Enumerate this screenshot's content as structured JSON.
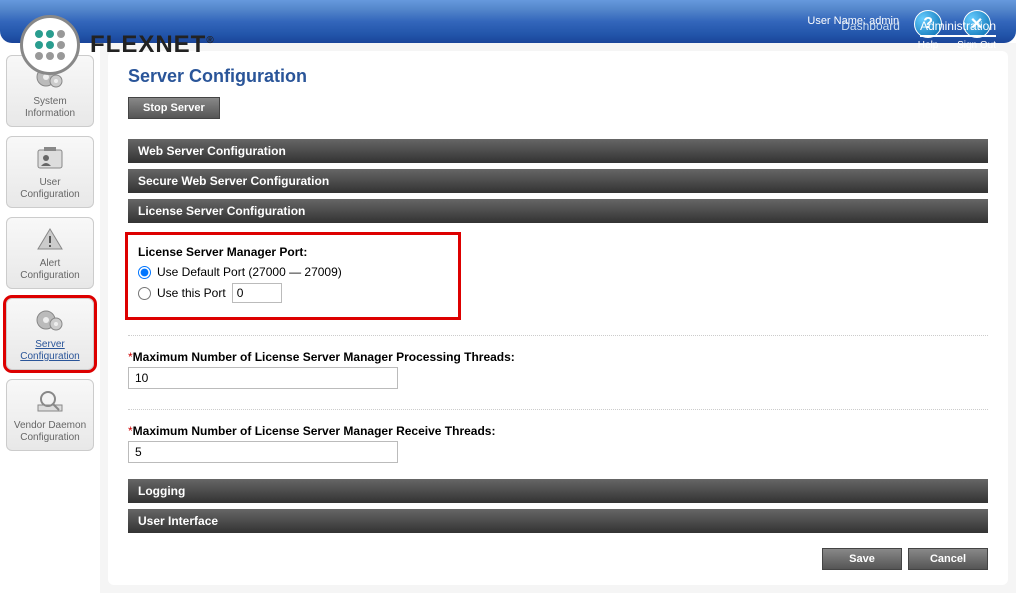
{
  "header": {
    "brand": "FLEXNET",
    "brand_suffix": "®",
    "user_label": "User Name: admin",
    "help": "Help",
    "signout": "Sign Out",
    "tabs": {
      "dashboard": "Dashboard",
      "admin": "Administration"
    }
  },
  "sidebar": {
    "sysinfo": "System Information",
    "userconf": "User Configuration",
    "alertconf": "Alert Configuration",
    "serverconf": "Server Configuration",
    "vendorconf": "Vendor Daemon Configuration"
  },
  "page": {
    "title": "Server Configuration",
    "stop": "Stop Server",
    "sections": {
      "web": "Web Server Configuration",
      "secure": "Secure Web Server Configuration",
      "license": "License Server Configuration",
      "logging": "Logging",
      "ui": "User Interface"
    },
    "port_block": {
      "title": "License Server Manager Port:",
      "opt1": "Use Default Port (27000 — 27009)",
      "opt2": "Use this Port",
      "port_value": "0"
    },
    "proc_threads": {
      "label": "Maximum Number of License Server Manager Processing Threads:",
      "value": "10"
    },
    "recv_threads": {
      "label": "Maximum Number of License Server Manager Receive Threads:",
      "value": "5"
    },
    "save": "Save",
    "cancel": "Cancel"
  }
}
